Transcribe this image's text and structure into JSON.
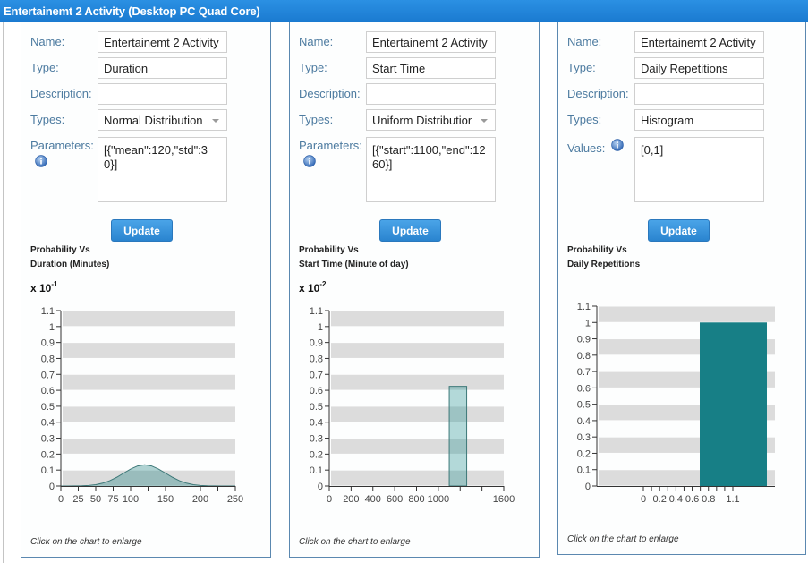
{
  "header": {
    "title": "Entertainemt 2 Activity (Desktop PC Quad Core)"
  },
  "theme": {
    "header": "#1e84da",
    "accent_button": "#2b8ad6",
    "label": "#4d7ba0",
    "panel_border": "#5b88b0",
    "chart_band": "#dcdcdc",
    "chart_axis": "#333333",
    "chart_tick_label": "#444444",
    "area_fill": "rgba(30,130,130,0.35)",
    "area_stroke": "#3d7878",
    "histogram_bar": "#177f86"
  },
  "panels": [
    {
      "name": {
        "label": "Name:",
        "value": "Entertainemt 2 Activity"
      },
      "type": {
        "label": "Type:",
        "value": "Duration"
      },
      "description": {
        "label": "Description:",
        "value": ""
      },
      "types": {
        "label": "Types:",
        "value": "Normal Distribution",
        "control": "dropdown"
      },
      "params": {
        "label": "Parameters:",
        "value": "[{\"mean\":120,\"std\":30}]"
      },
      "info_icon": "info-icon",
      "update_label": "Update",
      "chart_hint": "Click on the chart to enlarge"
    },
    {
      "name": {
        "label": "Name:",
        "value": "Entertainemt 2 Activity"
      },
      "type": {
        "label": "Type:",
        "value": "Start Time"
      },
      "description": {
        "label": "Description:",
        "value": ""
      },
      "types": {
        "label": "Types:",
        "value": "Uniform Distribution",
        "control": "dropdown"
      },
      "params": {
        "label": "Parameters:",
        "value": "[{\"start\":1100,\"end\":1260}]"
      },
      "info_icon": "info-icon",
      "update_label": "Update",
      "chart_hint": "Click on the chart to enlarge"
    },
    {
      "name": {
        "label": "Name:",
        "value": "Entertainemt 2 Activity"
      },
      "type": {
        "label": "Type:",
        "value": "Daily Repetitions"
      },
      "description": {
        "label": "Description:",
        "value": ""
      },
      "types": {
        "label": "Types:",
        "value": "Histogram",
        "control": "text"
      },
      "params": {
        "label": "Values:",
        "value": "[0,1]"
      },
      "info_icon": "info-icon",
      "update_label": "Update",
      "chart_hint": "Click on the chart to enlarge"
    }
  ],
  "chart_data": [
    {
      "type": "area",
      "title": "Probability Vs Duration (Minutes)",
      "title_line1": "Probability Vs",
      "title_line2": "Duration (Minutes)",
      "multiplier_base": "x 10",
      "multiplier_exp": "-1",
      "xlabel": "Duration (Minutes)",
      "ylabel": "Probability (x 10^-1)",
      "xlim": [
        0,
        250
      ],
      "ylim": [
        0,
        1.1
      ],
      "grid": "alternating-bands",
      "legend": "none",
      "distribution": {
        "kind": "normal",
        "mean": 120,
        "std": 30
      },
      "y_ticks": [
        {
          "value": 0,
          "label": "0"
        },
        {
          "value": 0.1,
          "label": "0.1"
        },
        {
          "value": 0.2,
          "label": "0.2"
        },
        {
          "value": 0.3,
          "label": "0.3"
        },
        {
          "value": 0.4,
          "label": "0.4"
        },
        {
          "value": 0.5,
          "label": "0.5"
        },
        {
          "value": 0.6,
          "label": "0.6"
        },
        {
          "value": 0.7,
          "label": "0.7"
        },
        {
          "value": 0.8,
          "label": "0.8"
        },
        {
          "value": 0.9,
          "label": "0.9"
        },
        {
          "value": 1,
          "label": "1"
        },
        {
          "value": 1.1,
          "label": "1.1"
        }
      ],
      "x_ticks": [
        {
          "value": 0,
          "label": "0"
        },
        {
          "value": 25,
          "label": "25"
        },
        {
          "value": 50,
          "label": "50"
        },
        {
          "value": 75,
          "label": "75"
        },
        {
          "value": 100,
          "label": "100"
        },
        {
          "value": 125,
          "label": ""
        },
        {
          "value": 150,
          "label": "150"
        },
        {
          "value": 175,
          "label": ""
        },
        {
          "value": 200,
          "label": "200"
        },
        {
          "value": 225,
          "label": ""
        },
        {
          "value": 250,
          "label": "250"
        }
      ],
      "series": [
        {
          "name": "Normal Distribution",
          "x": [
            0,
            10,
            20,
            30,
            40,
            50,
            60,
            70,
            80,
            90,
            100,
            110,
            120,
            130,
            140,
            150,
            160,
            170,
            180,
            190,
            200,
            210,
            220,
            230,
            240,
            250
          ],
          "y": [
            0.0,
            0.0002,
            0.0005,
            0.0015,
            0.0038,
            0.0087,
            0.018,
            0.0332,
            0.0547,
            0.0807,
            0.1065,
            0.1258,
            0.133,
            0.1258,
            0.1065,
            0.0807,
            0.0547,
            0.0332,
            0.018,
            0.0087,
            0.0038,
            0.0015,
            0.0005,
            0.0002,
            0.0,
            0.0
          ]
        }
      ]
    },
    {
      "type": "bar",
      "title": "Probability Vs Start Time (Minute of day)",
      "title_line1": "Probability Vs",
      "title_line2": "Start Time (Minute of day)",
      "multiplier_base": "x 10",
      "multiplier_exp": "-2",
      "xlabel": "Start Time (Minute of day)",
      "ylabel": "Probability (x 10^-2)",
      "xlim": [
        0,
        1600
      ],
      "ylim": [
        0,
        1.1
      ],
      "grid": "alternating-bands",
      "legend": "none",
      "distribution": {
        "kind": "uniform",
        "start": 1100,
        "end": 1260
      },
      "y_ticks": [
        {
          "value": 0,
          "label": "0"
        },
        {
          "value": 0.1,
          "label": "0.1"
        },
        {
          "value": 0.2,
          "label": "0.2"
        },
        {
          "value": 0.3,
          "label": "0.3"
        },
        {
          "value": 0.4,
          "label": "0.4"
        },
        {
          "value": 0.5,
          "label": "0.5"
        },
        {
          "value": 0.6,
          "label": "0.6"
        },
        {
          "value": 0.7,
          "label": "0.7"
        },
        {
          "value": 0.8,
          "label": "0.8"
        },
        {
          "value": 0.9,
          "label": "0.9"
        },
        {
          "value": 1,
          "label": "1"
        },
        {
          "value": 1.1,
          "label": "1.1"
        }
      ],
      "x_ticks": [
        {
          "value": 0,
          "label": "0"
        },
        {
          "value": 200,
          "label": "200"
        },
        {
          "value": 400,
          "label": "400"
        },
        {
          "value": 600,
          "label": "600"
        },
        {
          "value": 800,
          "label": "800"
        },
        {
          "value": 1000,
          "label": "1000"
        },
        {
          "value": 1200,
          "label": ""
        },
        {
          "value": 1400,
          "label": ""
        },
        {
          "value": 1600,
          "label": "1600"
        }
      ],
      "bars": [
        {
          "x0": 1100,
          "x1": 1260,
          "value": 0.625
        }
      ]
    },
    {
      "type": "bar",
      "title": "Probability Vs Daily Repetitions",
      "title_line1": "Probability Vs",
      "title_line2": "Daily Repetitions",
      "xlabel": "Daily Repetitions",
      "ylabel": "Probability",
      "xlim": [
        0,
        1.1
      ],
      "ylim": [
        0,
        1.1
      ],
      "grid": "alternating-bands",
      "legend": "none",
      "y_ticks": [
        {
          "value": 0,
          "label": "0"
        },
        {
          "value": 0.1,
          "label": "0.1"
        },
        {
          "value": 0.2,
          "label": "0.2"
        },
        {
          "value": 0.3,
          "label": "0.3"
        },
        {
          "value": 0.4,
          "label": "0.4"
        },
        {
          "value": 0.5,
          "label": "0.5"
        },
        {
          "value": 0.6,
          "label": "0.6"
        },
        {
          "value": 0.7,
          "label": "0.7"
        },
        {
          "value": 0.8,
          "label": "0.8"
        },
        {
          "value": 0.9,
          "label": "0.9"
        },
        {
          "value": 1,
          "label": "1"
        },
        {
          "value": 1.1,
          "label": "1.1"
        }
      ],
      "x_ticks": [
        {
          "value": 0,
          "label": "0"
        },
        {
          "value": 0.1,
          "label": ""
        },
        {
          "value": 0.2,
          "label": "0.2"
        },
        {
          "value": 0.3,
          "label": ""
        },
        {
          "value": 0.4,
          "label": "0.4"
        },
        {
          "value": 0.5,
          "label": ""
        },
        {
          "value": 0.6,
          "label": "0.6"
        },
        {
          "value": 0.7,
          "label": ""
        },
        {
          "value": 0.8,
          "label": "0.8"
        },
        {
          "value": 0.9,
          "label": ""
        },
        {
          "value": 1.0,
          "label": ""
        },
        {
          "value": 1.1,
          "label": "1.1"
        }
      ],
      "bars": [
        {
          "label": "1",
          "value": 1.0
        }
      ]
    }
  ]
}
